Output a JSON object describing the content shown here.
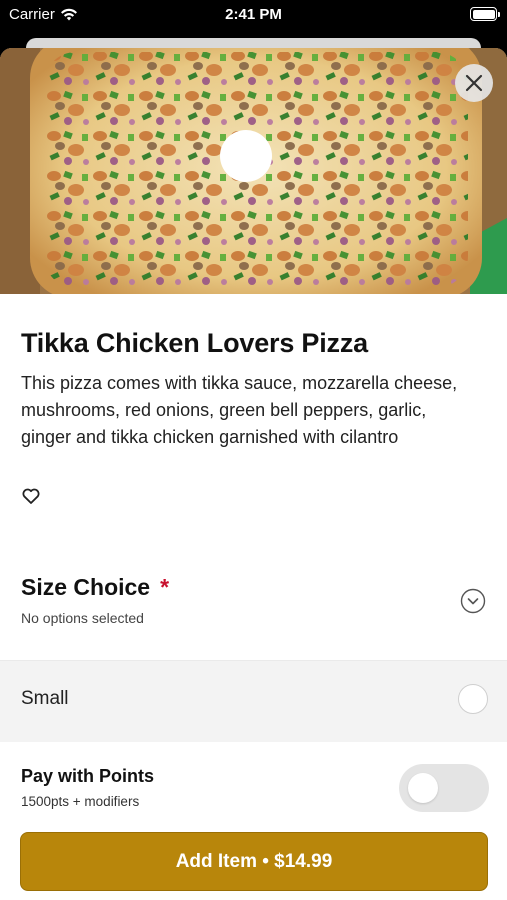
{
  "status_bar": {
    "carrier": "Carrier",
    "time": "2:41 PM",
    "icons": [
      "wifi-icon",
      "battery-icon"
    ]
  },
  "product": {
    "name": "Tikka Chicken Lovers Pizza",
    "description": "This pizza comes with tikka sauce, mozzarella cheese, mushrooms, red onions, green bell peppers, garlic, ginger and tikka chicken garnished with cilantro",
    "favorite_icon": "heart-outline-icon",
    "close_icon": "close-icon"
  },
  "size_choice": {
    "title": "Size Choice",
    "required_marker": "*",
    "status": "No options selected",
    "expand_icon": "chevron-down-circle-icon",
    "options": [
      {
        "label": "Small",
        "selected": false
      }
    ]
  },
  "points": {
    "title": "Pay with Points",
    "subtitle": "1500pts + modifiers",
    "enabled": false
  },
  "cta": {
    "label": "Add Item • $14.99"
  },
  "colors": {
    "accent": "#b8860b",
    "required": "#c8102e"
  }
}
